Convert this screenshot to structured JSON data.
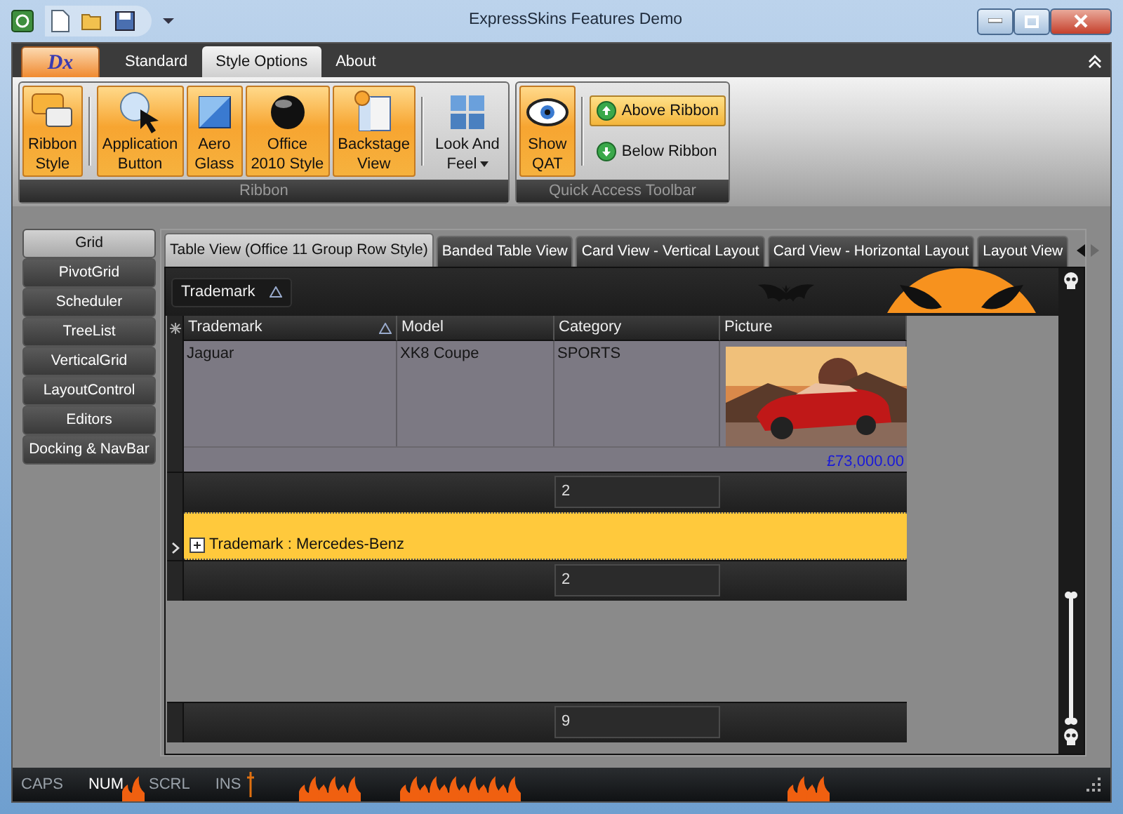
{
  "window": {
    "title": "ExpressSkins Features Demo"
  },
  "ribbon": {
    "app_button": "Dx",
    "tabs": [
      {
        "label": "Standard",
        "selected": false
      },
      {
        "label": "Style Options",
        "selected": true
      },
      {
        "label": "About",
        "selected": false
      }
    ],
    "groups": [
      {
        "caption": "Ribbon",
        "items": [
          {
            "kind": "large",
            "label": "Ribbon\nStyle",
            "checked": true
          },
          {
            "kind": "separator"
          },
          {
            "kind": "large",
            "label": "Application\nButton",
            "checked": true
          },
          {
            "kind": "large",
            "label": "Aero\nGlass",
            "checked": true
          },
          {
            "kind": "large",
            "label": "Office\n2010 Style",
            "checked": true
          },
          {
            "kind": "large",
            "label": "Backstage\nView",
            "checked": true
          },
          {
            "kind": "separator"
          },
          {
            "kind": "large",
            "label": "Look And\nFeel",
            "checked": false,
            "dropdown": true
          }
        ]
      },
      {
        "caption": "Quick Access Toolbar",
        "items": [
          {
            "kind": "large",
            "label": "Show\nQAT",
            "checked": true
          },
          {
            "kind": "separator"
          },
          {
            "kind": "small",
            "label": "Above Ribbon",
            "checked": true
          },
          {
            "kind": "small",
            "label": "Below Ribbon",
            "checked": false
          }
        ]
      }
    ]
  },
  "nav": [
    {
      "label": "Grid",
      "selected": true
    },
    {
      "label": "PivotGrid",
      "selected": false
    },
    {
      "label": "Scheduler",
      "selected": false
    },
    {
      "label": "TreeList",
      "selected": false
    },
    {
      "label": "VerticalGrid",
      "selected": false
    },
    {
      "label": "LayoutControl",
      "selected": false
    },
    {
      "label": "Editors",
      "selected": false
    },
    {
      "label": "Docking & NavBar",
      "selected": false
    }
  ],
  "grid_tabs": [
    {
      "label": "Table View (Office 11 Group Row Style)",
      "selected": true
    },
    {
      "label": "Banded Table View",
      "selected": false
    },
    {
      "label": "Card View - Vertical Layout",
      "selected": false
    },
    {
      "label": "Card View - Horizontal Layout",
      "selected": false
    },
    {
      "label": "Layout View",
      "selected": false
    }
  ],
  "group_panel": {
    "label": "Trademark",
    "sorted": true
  },
  "columns": [
    {
      "label": "Trademark",
      "sorted": true
    },
    {
      "label": "Model",
      "sorted": false
    },
    {
      "label": "Category",
      "sorted": false
    },
    {
      "label": "Picture",
      "sorted": false
    }
  ],
  "rows": [
    {
      "kind": "data",
      "cells": [
        "Jaguar",
        "XK8 Coupe",
        "SPORTS"
      ],
      "picture": {
        "kind": "picture"
      },
      "preview": "£73,000.00"
    },
    {
      "kind": "group_footer",
      "value": "2"
    },
    {
      "kind": "group",
      "label": "Trademark : Mercedes-Benz",
      "expanded": false,
      "selected": true
    },
    {
      "kind": "group_footer",
      "value": "2"
    }
  ],
  "footer": {
    "value": "9"
  },
  "status_bar": [
    {
      "label": "CAPS",
      "on": false
    },
    {
      "label": "NUM",
      "on": true
    },
    {
      "label": "SCRL",
      "on": false
    },
    {
      "label": "INS",
      "on": false
    }
  ]
}
